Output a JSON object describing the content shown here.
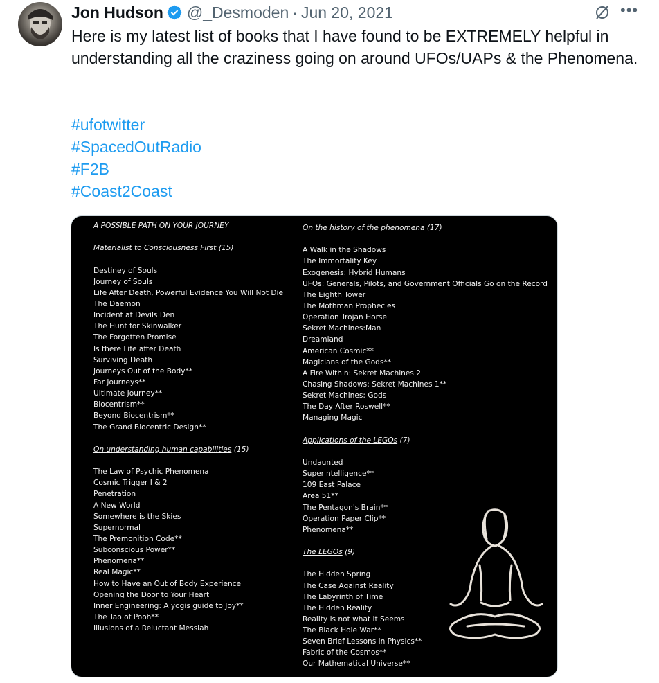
{
  "author": {
    "name": "Jon Hudson",
    "handle": "@_Desmoden",
    "separator": "·",
    "date": "Jun 20, 2021",
    "verified_icon": "verified-badge-icon",
    "avatar_icon": "user-avatar"
  },
  "actions": {
    "grok_icon": "grok-slash-icon",
    "more_label": "•••"
  },
  "tweet": {
    "text": "Here is my latest list of books that I have found to be EXTREMELY helpful in understanding all the craziness going on around UFOs/UAPs & the Phenomena.",
    "hashtags": [
      "#ufotwitter",
      "#SpacedOutRadio",
      "#F2B",
      "#Coast2Coast"
    ]
  },
  "image": {
    "title": "A POSSIBLE PATH ON YOUR JOURNEY",
    "sections": {
      "materialist": {
        "title": "Materialist to Consciousness First",
        "count": "(15)",
        "items": [
          "Destiney of Souls",
          "Journey of Souls",
          "Life After Death, Powerful Evidence You Will Not Die",
          "The Daemon",
          "Incident at Devils Den",
          "The Hunt for Skinwalker",
          "The Forgotten Promise",
          "Is there Life after Death",
          "Surviving Death",
          "Journeys Out of the Body**",
          "Far Journeys**",
          "Ultimate Journey**",
          "Biocentrism**",
          "Beyond Biocentrism**",
          "The Grand Biocentric Design**"
        ]
      },
      "human": {
        "title": "On understanding human capabilities",
        "count": "(15)",
        "items": [
          "The Law of Psychic Phenomena",
          "Cosmic Trigger I & 2",
          "Penetration",
          "A New World",
          "Somewhere is the Skies",
          "Supernormal",
          "The Premonition Code**",
          "Subconscious Power**",
          "Phenomena**",
          "Real Magic**",
          "How to Have an Out of Body Experience",
          "Opening the Door to Your Heart",
          "Inner Engineering: A yogis guide to Joy**",
          "The Tao of Pooh**",
          "Illusions of a Reluctant Messiah"
        ]
      },
      "history": {
        "title": "On the history of the phenomena",
        "count": "(17)",
        "items": [
          "A Walk in the Shadows",
          "The Immortality Key",
          "Exogenesis: Hybrid Humans",
          "UFOs: Generals, Pilots, and Government Officials Go on the Record",
          "The Eighth Tower",
          "The Mothman Prophecies",
          "Operation Trojan Horse",
          "Sekret Machines:Man",
          "Dreamland",
          "American Cosmic**",
          "Magicians of the Gods**",
          "A Fire Within: Sekret Machines 2",
          "Chasing Shadows: Sekret Machines 1**",
          "Sekret Machines: Gods",
          "The Day After Roswell**",
          "Managing Magic"
        ]
      },
      "applications": {
        "title": "Applications of the LEGOs",
        "count": "(7)",
        "items": [
          "Undaunted",
          "Superintelligence**",
          "109 East Palace",
          "Area 51**",
          "The Pentagon's Brain**",
          "Operation Paper Clip**",
          "Phenomena**"
        ]
      },
      "legos": {
        "title": "The LEGOs",
        "count": "(9)",
        "items": [
          "The Hidden Spring",
          "The Case Against Reality",
          "The Labyrinth of Time",
          "The Hidden Reality",
          "Reality is not what it Seems",
          "The Black Hole War**",
          "Seven Brief Lessons in Physics**",
          "Fabric of the Cosmos**",
          "Our Mathematical Universe**"
        ]
      }
    },
    "illustration_icon": "meditating-figure-illustration"
  }
}
